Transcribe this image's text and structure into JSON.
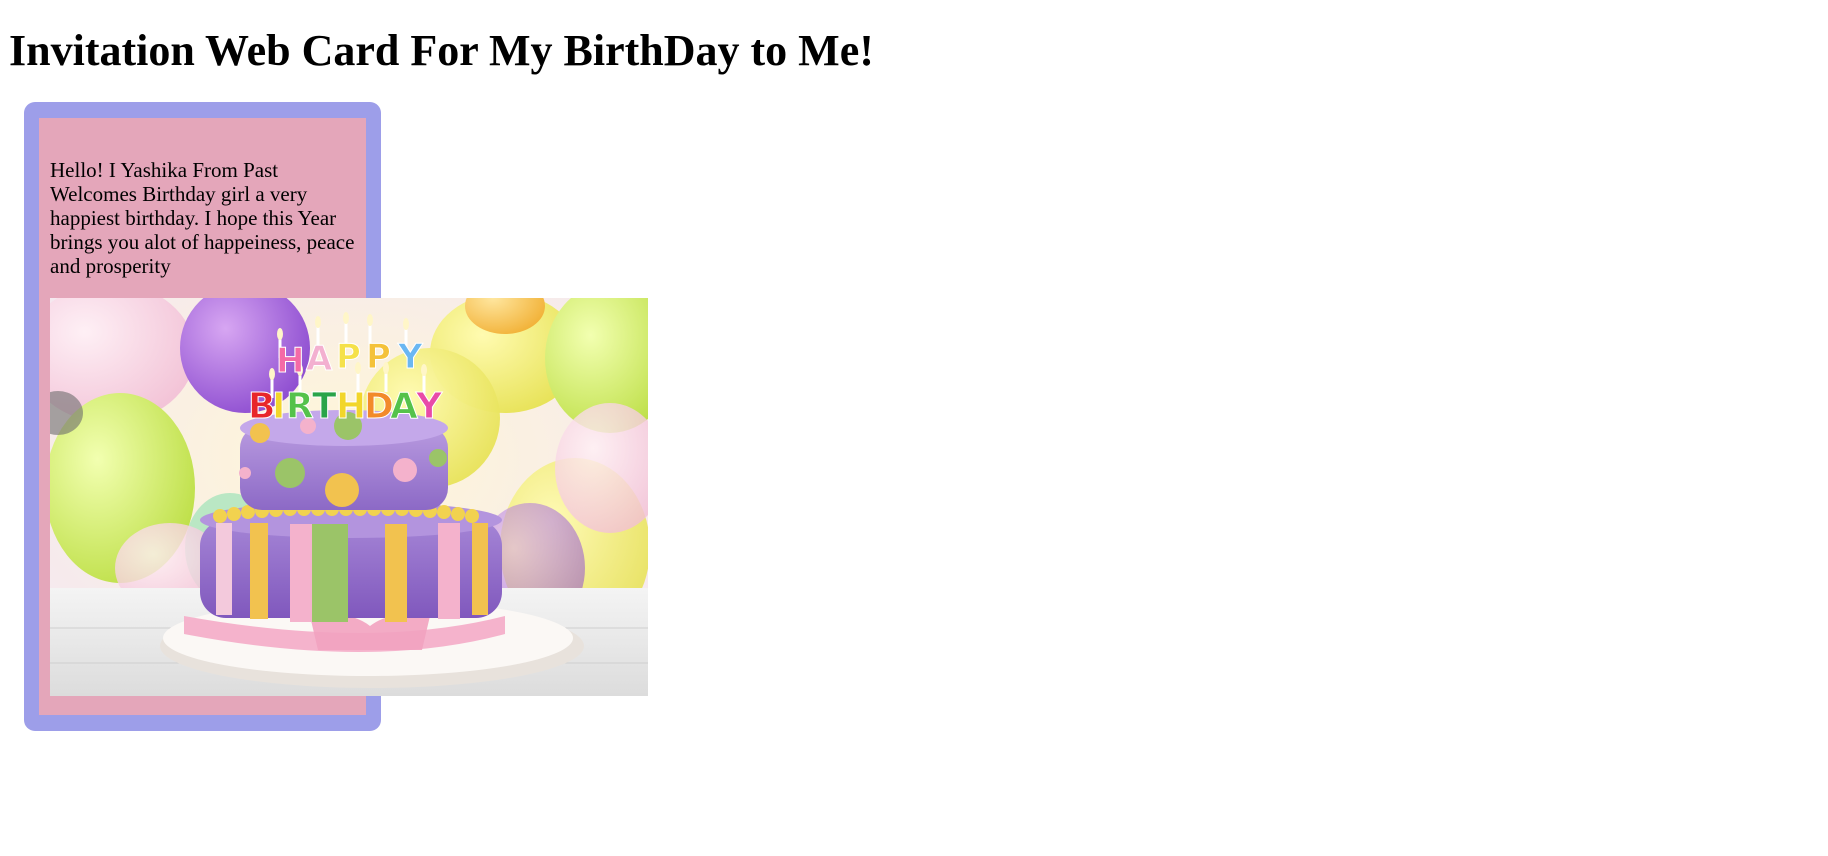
{
  "page": {
    "title": "Invitation Web Card For My BirthDay to Me!"
  },
  "card": {
    "message": "Hello! I Yashika From Past Welcomes Birthday girl a very happiest birthday. I hope this Year brings you alot of happeiness, peace and prosperity",
    "frame_color": "#9d9ee9",
    "inner_color": "#e4a6ba",
    "image": {
      "subject": "birthday-cake-photo",
      "topper_line1": "HAPPY",
      "topper_line2": "BIRTHDAY"
    }
  }
}
